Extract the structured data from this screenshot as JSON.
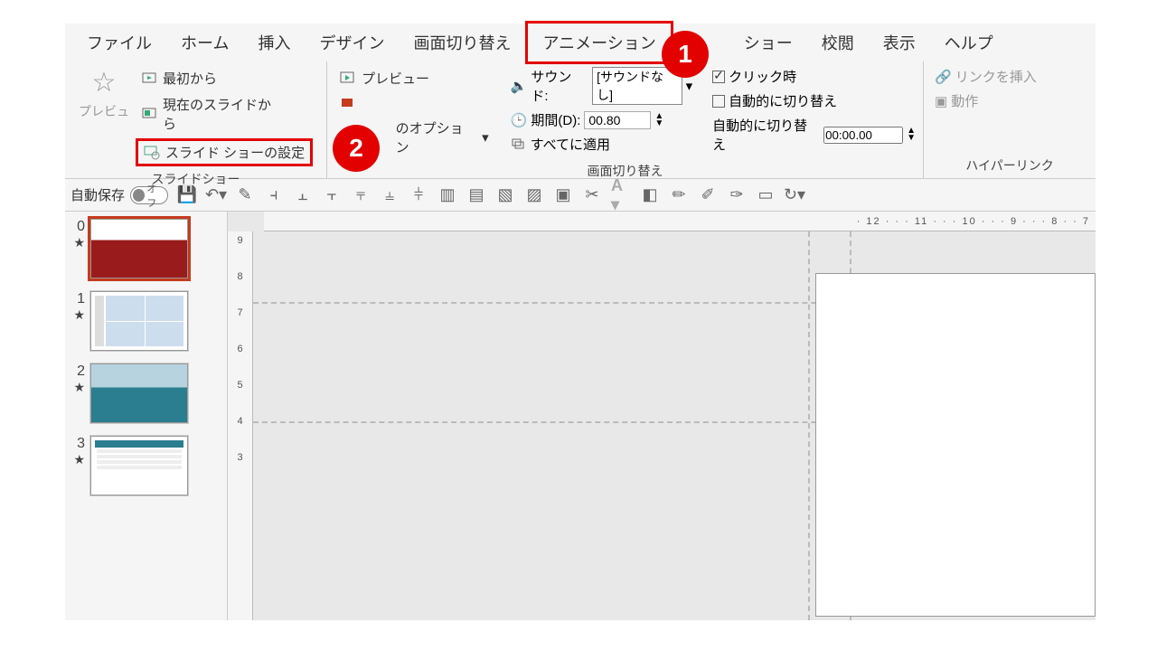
{
  "tabs": {
    "file": "ファイル",
    "home": "ホーム",
    "insert": "挿入",
    "design": "デザイン",
    "transitions": "画面切り替え",
    "animations": "アニメーション",
    "slideshow": "ショー",
    "review": "校閲",
    "view": "表示",
    "help": "ヘルプ"
  },
  "badges": {
    "one": "1",
    "two": "2"
  },
  "ribbon": {
    "preview_label": "プレビュ",
    "slideshow_group": {
      "label": "スライドショー",
      "from_start": "最初から",
      "from_current": "現在のスライドから",
      "setup": "スライド ショーの設定"
    },
    "preview_small": "プレビュー",
    "options_label": "のオプション",
    "transition_group": {
      "label": "画面切り替え",
      "sound_label": "サウンド:",
      "sound_value": "[サウンドなし]",
      "duration_label": "期間(D):",
      "duration_value": "00.80",
      "apply_all": "すべてに適用"
    },
    "timing": {
      "on_click": "クリック時",
      "auto_after_label": "自動的に切り替え",
      "auto_after_row": "自動的に切り替え",
      "auto_after_value": "00:00.00"
    },
    "hyperlink": {
      "label": "ハイパーリンク",
      "insert": "リンクを挿入",
      "action": "動作"
    }
  },
  "qat": {
    "autosave_label": "自動保存",
    "toggle_text": "オフ"
  },
  "thumbnails": [
    {
      "num": "0",
      "star": "★"
    },
    {
      "num": "1",
      "star": "★"
    },
    {
      "num": "2",
      "star": "★"
    },
    {
      "num": "3",
      "star": "★"
    }
  ],
  "ruler_h": "· 12 · · · 11 · · · 10 · · · 9 · · · 8 · · 7",
  "ruler_v": [
    "9",
    "8",
    "7",
    "6",
    "5",
    "4",
    "3"
  ]
}
